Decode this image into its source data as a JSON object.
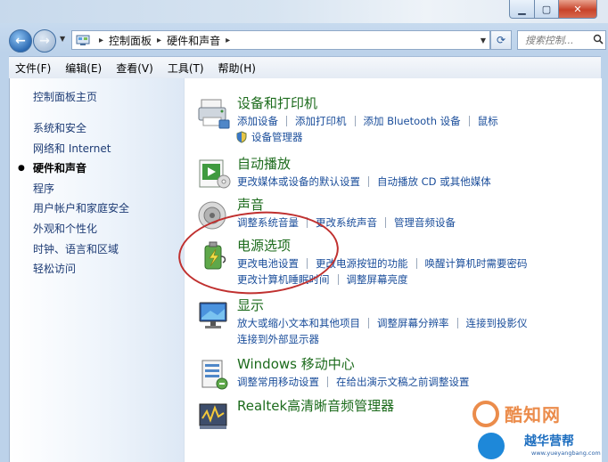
{
  "address": {
    "crumbs": [
      "控制面板",
      "硬件和声音"
    ]
  },
  "search": {
    "placeholder": "搜索控制..."
  },
  "menu": [
    "文件(F)",
    "编辑(E)",
    "查看(V)",
    "工具(T)",
    "帮助(H)"
  ],
  "sidebar": {
    "home": "控制面板主页",
    "items": [
      "系统和安全",
      "网络和 Internet",
      "硬件和声音",
      "程序",
      "用户帐户和家庭安全",
      "外观和个性化",
      "时钟、语言和区域",
      "轻松访问"
    ],
    "current_index": 2
  },
  "categories": [
    {
      "title": "设备和打印机",
      "icon": "printer-icon",
      "rows": [
        [
          "添加设备",
          "添加打印机",
          "添加 Bluetooth 设备",
          "鼠标"
        ],
        [
          "设备管理器"
        ]
      ]
    },
    {
      "title": "自动播放",
      "icon": "autoplay-icon",
      "rows": [
        [
          "更改媒体或设备的默认设置",
          "自动播放 CD 或其他媒体"
        ]
      ]
    },
    {
      "title": "声音",
      "icon": "speaker-icon",
      "rows": [
        [
          "调整系统音量",
          "更改系统声音",
          "管理音频设备"
        ]
      ]
    },
    {
      "title": "电源选项",
      "icon": "power-icon",
      "rows": [
        [
          "更改电池设置",
          "更改电源按钮的功能",
          "唤醒计算机时需要密码"
        ],
        [
          "更改计算机睡眠时间",
          "调整屏幕亮度"
        ]
      ]
    },
    {
      "title": "显示",
      "icon": "display-icon",
      "rows": [
        [
          "放大或缩小文本和其他项目",
          "调整屏幕分辨率",
          "连接到投影仪"
        ],
        [
          "连接到外部显示器"
        ]
      ]
    },
    {
      "title": "Windows 移动中心",
      "icon": "mobility-center-icon",
      "rows": [
        [
          "调整常用移动设置",
          "在给出演示文稿之前调整设置"
        ]
      ]
    },
    {
      "title": "Realtek高清晰音频管理器",
      "icon": "realtek-audio-icon",
      "rows": []
    }
  ],
  "watermark": {
    "brand1": "酷知网",
    "brand2": "越华营帮",
    "url": "www.yueyangbang.com"
  },
  "colors": {
    "link": "#1a4d9a",
    "category_title": "#1c6b1c",
    "annotation": "#c0302f"
  }
}
